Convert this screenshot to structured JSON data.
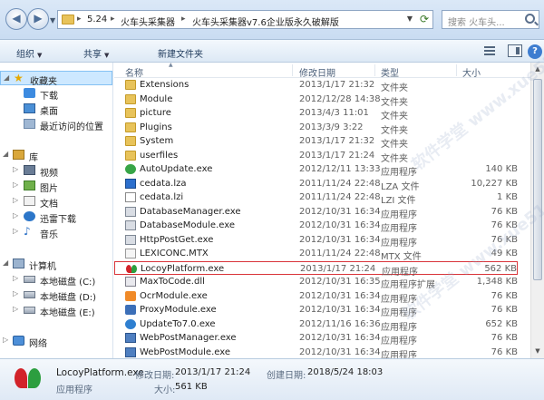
{
  "address": {
    "crumbs": [
      "5.24",
      "火车头采集器",
      "火车头采集器v7.6企业版永久破解版"
    ],
    "search_placeholder": "搜索 火车头..."
  },
  "toolbar": {
    "organize": "组织",
    "share": "共享",
    "new_folder": "新建文件夹"
  },
  "nav": {
    "favorites": "收藏夹",
    "downloads": "下载",
    "desktop": "桌面",
    "recent": "最近访问的位置",
    "libraries": "库",
    "videos": "视频",
    "pictures": "图片",
    "documents": "文档",
    "thunder": "迅雷下载",
    "music": "音乐",
    "computer": "计算机",
    "disk_c": "本地磁盘 (C:)",
    "disk_d": "本地磁盘 (D:)",
    "disk_e": "本地磁盘 (E:)",
    "network": "网络"
  },
  "columns": {
    "name": "名称",
    "date": "修改日期",
    "type": "类型",
    "size": "大小"
  },
  "files": [
    {
      "name": "Extensions",
      "date": "2013/1/17 21:32",
      "type": "文件夹",
      "size": "",
      "icon": "folder-icon"
    },
    {
      "name": "Module",
      "date": "2012/12/28 14:38",
      "type": "文件夹",
      "size": "",
      "icon": "folder-icon"
    },
    {
      "name": "picture",
      "date": "2013/4/3 11:01",
      "type": "文件夹",
      "size": "",
      "icon": "folder-icon"
    },
    {
      "name": "Plugins",
      "date": "2013/3/9 3:22",
      "type": "文件夹",
      "size": "",
      "icon": "folder-icon"
    },
    {
      "name": "System",
      "date": "2013/1/17 21:32",
      "type": "文件夹",
      "size": "",
      "icon": "folder-icon"
    },
    {
      "name": "userfiles",
      "date": "2013/1/17 21:24",
      "type": "文件夹",
      "size": "",
      "icon": "folder-icon"
    },
    {
      "name": "AutoUpdate.exe",
      "date": "2012/12/11 13:33",
      "type": "应用程序",
      "size": "140 KB",
      "icon": "update-icon"
    },
    {
      "name": "cedata.lza",
      "date": "2011/11/24 22:48",
      "type": "LZA 文件",
      "size": "10,227 KB",
      "icon": "lza-file-icon"
    },
    {
      "name": "cedata.lzi",
      "date": "2011/11/24 22:48",
      "type": "LZI 文件",
      "size": "1 KB",
      "icon": "blank-file-icon"
    },
    {
      "name": "DatabaseManager.exe",
      "date": "2012/10/31 16:34",
      "type": "应用程序",
      "size": "76 KB",
      "icon": "database-icon"
    },
    {
      "name": "DatabaseModule.exe",
      "date": "2012/10/31 16:34",
      "type": "应用程序",
      "size": "76 KB",
      "icon": "database-icon"
    },
    {
      "name": "HttpPostGet.exe",
      "date": "2012/10/31 16:34",
      "type": "应用程序",
      "size": "76 KB",
      "icon": "database-icon"
    },
    {
      "name": "LEXICONC.MTX",
      "date": "2011/11/24 22:48",
      "type": "MTX 文件",
      "size": "49 KB",
      "icon": "mtx-file-icon"
    },
    {
      "name": "LocoyPlatform.exe",
      "date": "2013/1/17 21:24",
      "type": "应用程序",
      "size": "562 KB",
      "icon": "locoy-logo-icon"
    },
    {
      "name": "MaxToCode.dll",
      "date": "2012/10/31 16:35",
      "type": "应用程序扩展",
      "size": "1,348 KB",
      "icon": "dll-file-icon"
    },
    {
      "name": "OcrModule.exe",
      "date": "2012/10/31 16:34",
      "type": "应用程序",
      "size": "76 KB",
      "icon": "ocr-icon"
    },
    {
      "name": "ProxyModule.exe",
      "date": "2012/10/31 16:34",
      "type": "应用程序",
      "size": "76 KB",
      "icon": "proxy-icon"
    },
    {
      "name": "UpdateTo7.0.exe",
      "date": "2012/11/16 16:36",
      "type": "应用程序",
      "size": "652 KB",
      "icon": "globe-icon"
    },
    {
      "name": "WebPostManager.exe",
      "date": "2012/10/31 16:34",
      "type": "应用程序",
      "size": "76 KB",
      "icon": "web-icon"
    },
    {
      "name": "WebPostModule.exe",
      "date": "2012/10/31 16:34",
      "type": "应用程序",
      "size": "76 KB",
      "icon": "web-icon"
    }
  ],
  "details": {
    "name": "LocoyPlatform.exe",
    "type": "应用程序",
    "modified_label": "修改日期:",
    "modified_value": "2013/1/17 21:24",
    "created_label": "创建日期:",
    "created_value": "2018/5/24 18:03",
    "size_label": "大小:",
    "size_value": "561 KB"
  },
  "watermark": "软件学堂 www.xue51.com"
}
